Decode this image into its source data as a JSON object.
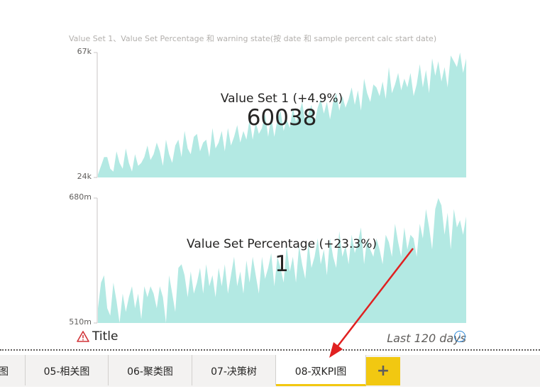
{
  "visual": {
    "title": "Value Set 1、Value Set Percentage 和 warning state(按 date 和 sample percent calc start date)",
    "warning_icon": "warning-triangle-icon",
    "warning_text": "Title",
    "period_text": "Last 120 days",
    "info_icon": "info-circle-icon",
    "info_glyph": "i",
    "area_color": "#b3e9e3",
    "warning_color": "#d13438"
  },
  "kpis": [
    {
      "label": "Value Set 1 (+4.9%)",
      "value": "60038",
      "y_max": "67k",
      "y_min": "24k"
    },
    {
      "label": "Value Set Percentage (+23.3%)",
      "value": "1",
      "y_max": "680m",
      "y_min": "510m"
    }
  ],
  "tabs": [
    {
      "label": "图",
      "active": false
    },
    {
      "label": "05-相关图",
      "active": false
    },
    {
      "label": "06-聚类图",
      "active": false
    },
    {
      "label": "07-决策树",
      "active": false
    },
    {
      "label": "08-双KPI图",
      "active": true
    }
  ],
  "add_tab": {
    "icon": "plus-icon",
    "glyph": "+"
  },
  "chart_data": [
    {
      "type": "area",
      "title": "Value Set 1 (+4.9%)",
      "ylim": [
        24000,
        67000
      ],
      "x_range": "Last 120 days",
      "values": [
        25000,
        28000,
        31000,
        31000,
        27000,
        26000,
        33000,
        29000,
        27000,
        34000,
        29000,
        26000,
        32000,
        28000,
        29000,
        31000,
        35000,
        30000,
        32000,
        36000,
        33000,
        28000,
        37000,
        32000,
        29000,
        35000,
        37000,
        31000,
        40000,
        34000,
        32000,
        38000,
        39000,
        33000,
        36000,
        37000,
        31000,
        41000,
        34000,
        36000,
        40000,
        33000,
        41000,
        35000,
        38000,
        42000,
        36000,
        40000,
        37000,
        44000,
        37000,
        43000,
        39000,
        41000,
        46000,
        38000,
        45000,
        38000,
        44000,
        47000,
        40000,
        44000,
        41000,
        48000,
        43000,
        46000,
        50000,
        43000,
        46000,
        49000,
        43000,
        48000,
        51000,
        46000,
        50000,
        44000,
        50000,
        53000,
        47000,
        52000,
        48000,
        51000,
        55000,
        49000,
        54000,
        47000,
        58000,
        53000,
        50000,
        56000,
        55000,
        52000,
        57000,
        51000,
        62000,
        53000,
        56000,
        60000,
        54000,
        58000,
        55000,
        60000,
        52000,
        56000,
        63000,
        55000,
        61000,
        53000,
        65000,
        59000,
        64000,
        57000,
        62000,
        55000,
        66000,
        64000,
        62000,
        67000,
        60000,
        65000
      ]
    },
    {
      "type": "area",
      "title": "Value Set Percentage (+23.3%)",
      "ylim": [
        0.51,
        0.68
      ],
      "x_range": "Last 120 days",
      "values": [
        0.53,
        0.565,
        0.575,
        0.53,
        0.52,
        0.565,
        0.54,
        0.51,
        0.55,
        0.525,
        0.545,
        0.56,
        0.53,
        0.55,
        0.515,
        0.56,
        0.545,
        0.56,
        0.55,
        0.53,
        0.56,
        0.545,
        0.51,
        0.575,
        0.55,
        0.525,
        0.585,
        0.59,
        0.575,
        0.545,
        0.58,
        0.55,
        0.565,
        0.585,
        0.55,
        0.59,
        0.56,
        0.575,
        0.545,
        0.585,
        0.56,
        0.59,
        0.55,
        0.575,
        0.6,
        0.56,
        0.58,
        0.55,
        0.595,
        0.565,
        0.6,
        0.575,
        0.55,
        0.6,
        0.57,
        0.585,
        0.605,
        0.56,
        0.6,
        0.585,
        0.565,
        0.615,
        0.58,
        0.6,
        0.565,
        0.615,
        0.59,
        0.57,
        0.62,
        0.585,
        0.6,
        0.625,
        0.59,
        0.61,
        0.575,
        0.625,
        0.6,
        0.585,
        0.635,
        0.6,
        0.615,
        0.59,
        0.63,
        0.605,
        0.62,
        0.64,
        0.59,
        0.625,
        0.61,
        0.6,
        0.625,
        0.61,
        0.59,
        0.63,
        0.62,
        0.6,
        0.645,
        0.62,
        0.6,
        0.64,
        0.61,
        0.63,
        0.625,
        0.6,
        0.645,
        0.625,
        0.665,
        0.64,
        0.61,
        0.665,
        0.68,
        0.67,
        0.63,
        0.66,
        0.61,
        0.665,
        0.64,
        0.65,
        0.63,
        0.655
      ]
    }
  ]
}
